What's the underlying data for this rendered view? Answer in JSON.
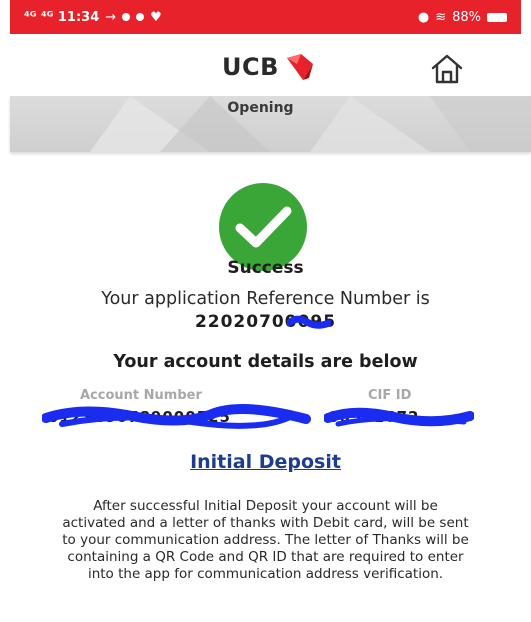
{
  "status_bar": {
    "left_text": "⁴ᴳ ⁴ᴳ 11:34",
    "battery_text": "88%"
  },
  "header": {
    "logo_text": "UCB",
    "home_icon": "home-icon"
  },
  "page": {
    "title": "Opening"
  },
  "result": {
    "status_icon": "success-check-icon",
    "status_label": "Success",
    "reference_line": "Your application Reference Number is",
    "reference_number": "22020700095"
  },
  "account": {
    "heading": "Your account details are below",
    "account_number_label": "Account Number",
    "account_number_value": "0123456789000525",
    "cif_label": "CIF ID",
    "cif_value": "00501672"
  },
  "actions": {
    "initial_deposit_label": "Initial Deposit"
  },
  "info": {
    "text": "After successful Initial Deposit your account will be activated and a letter of thanks with Debit card, will be sent to your communication address. The letter of Thanks will be containing a QR Code and QR ID that are required to enter into the app for communication address verification."
  },
  "colors": {
    "status_bar": "#e8222a",
    "success_green": "#3aa637",
    "link_blue": "#1d3d8f",
    "redaction_blue": "#1a2cf0"
  }
}
